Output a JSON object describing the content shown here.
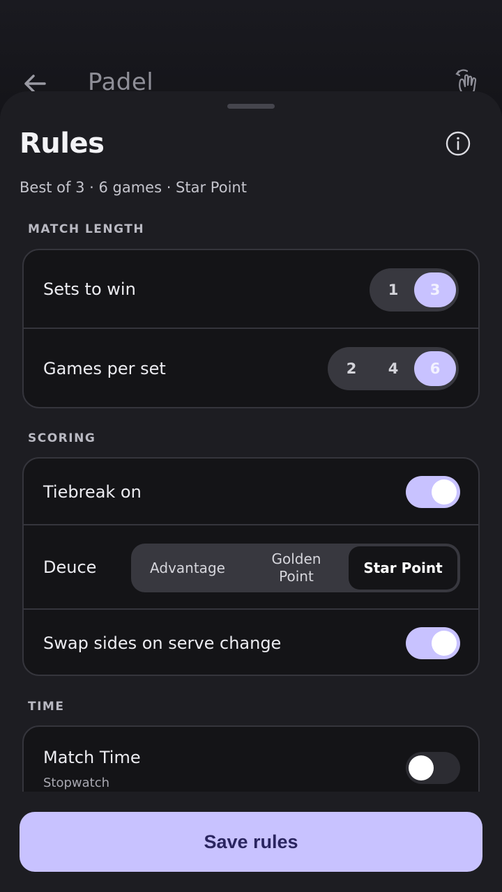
{
  "app_header": {
    "title": "Padel",
    "back_icon": "arrow-left-icon",
    "gesture_icon": "hand-swipe-icon"
  },
  "sheet": {
    "title": "Rules",
    "info_icon": "info-icon",
    "summary": "Best of 3 · 6 games · Star Point"
  },
  "match_length": {
    "label": "MATCH LENGTH",
    "sets_to_win": {
      "label": "Sets to win",
      "options": [
        "1",
        "3"
      ],
      "selected": "3"
    },
    "games_per_set": {
      "label": "Games per set",
      "options": [
        "2",
        "4",
        "6"
      ],
      "selected": "6"
    }
  },
  "scoring": {
    "label": "SCORING",
    "tiebreak": {
      "label": "Tiebreak on",
      "on": true
    },
    "deuce": {
      "label": "Deuce",
      "options": [
        "Advantage",
        "Golden Point",
        "Star Point"
      ],
      "selected": "Star Point"
    },
    "swap_sides": {
      "label": "Swap sides on serve change",
      "on": true
    }
  },
  "time": {
    "label": "TIME",
    "match_time": {
      "label": "Match Time",
      "sub": "Stopwatch",
      "on": false
    }
  },
  "actions": {
    "save_label": "Save rules"
  },
  "colors": {
    "accent": "#c8c2ff",
    "sheet_bg": "#1d1d22",
    "card_bg": "#141417",
    "button_text": "#2a2560"
  }
}
